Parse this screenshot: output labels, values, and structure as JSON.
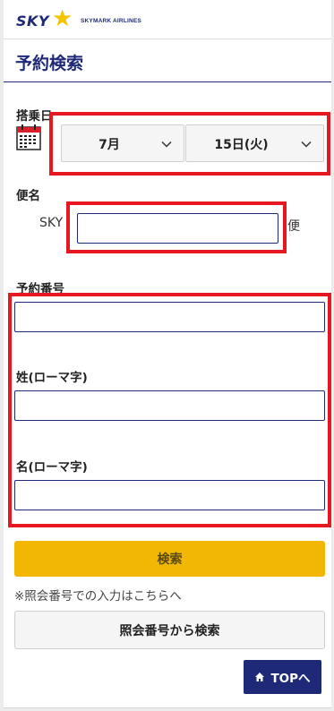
{
  "header": {
    "logo_sky": "SKY",
    "logo_airline": "SKYMARK AIRLINES",
    "page_title": "予約検索"
  },
  "date": {
    "label": "搭乗日",
    "month_value": "7月",
    "day_value": "15日(火)"
  },
  "flight": {
    "label": "便名",
    "prefix": "SKY",
    "suffix": "便",
    "value": ""
  },
  "reservation_number": {
    "label": "予約番号",
    "value": ""
  },
  "last_name": {
    "label": "姓(ローマ字)",
    "value": ""
  },
  "first_name": {
    "label": "名(ローマ字)",
    "value": ""
  },
  "search_button": "検索",
  "reference_note": "※照会番号での入力はこちらへ",
  "reference_button": "照会番号から検索",
  "top_button": "TOPへ",
  "colors": {
    "brand_navy": "#1e2a78",
    "search_yellow": "#f2b705",
    "highlight_red": "#e6171f"
  }
}
